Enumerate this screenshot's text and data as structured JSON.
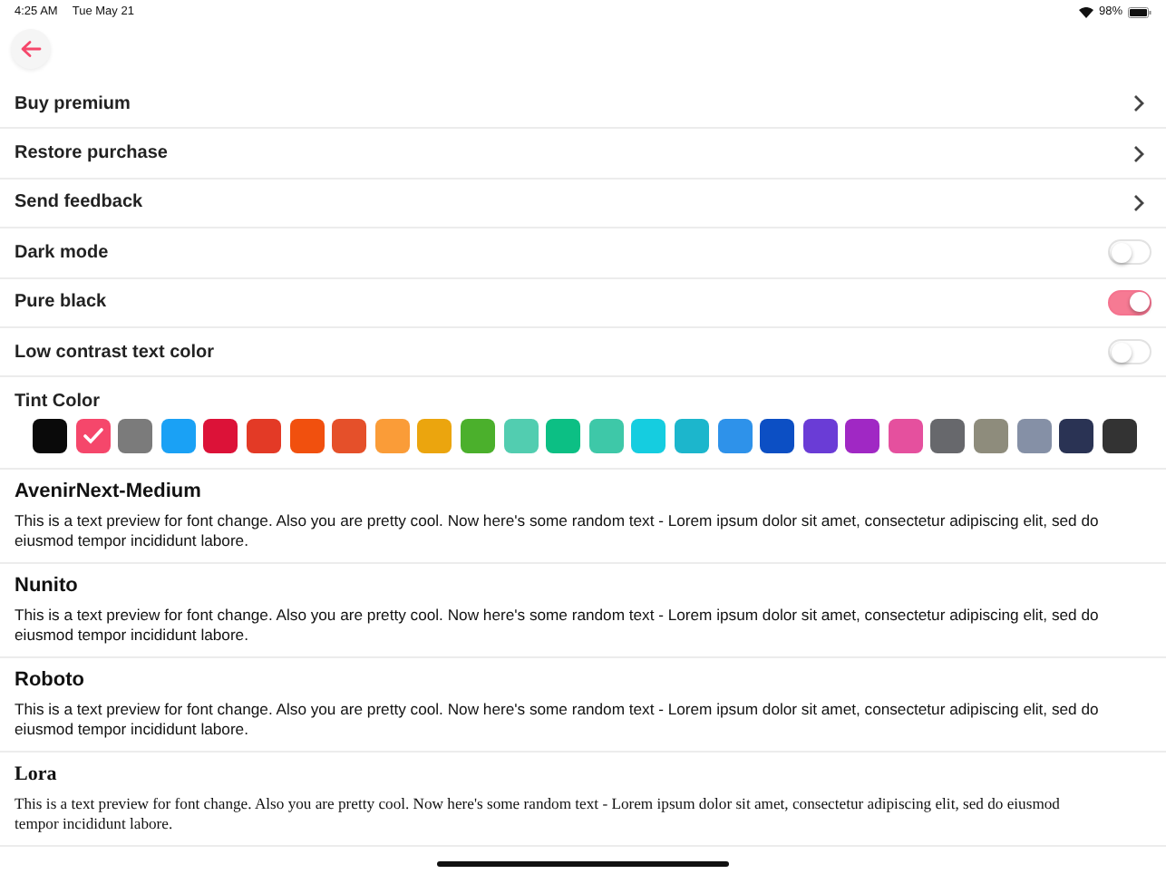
{
  "status_bar": {
    "time": "4:25 AM",
    "date": "Tue May 21",
    "battery": "98%"
  },
  "settings": [
    {
      "kind": "link",
      "label": "Buy premium"
    },
    {
      "kind": "link",
      "label": "Restore purchase"
    },
    {
      "kind": "link",
      "label": "Send feedback"
    },
    {
      "kind": "toggle",
      "label": "Dark mode",
      "on": false
    },
    {
      "kind": "toggle",
      "label": "Pure black",
      "on": true
    },
    {
      "kind": "toggle",
      "label": "Low contrast text color",
      "on": false
    }
  ],
  "tint": {
    "label": "Tint Color",
    "swatches": [
      {
        "color": "#0a0a0a",
        "selected": false
      },
      {
        "color": "#f5476b",
        "selected": true
      },
      {
        "color": "#7b7b7b",
        "selected": false
      },
      {
        "color": "#1aa1f5",
        "selected": false
      },
      {
        "color": "#dc1238",
        "selected": false
      },
      {
        "color": "#e33a26",
        "selected": false
      },
      {
        "color": "#f1500e",
        "selected": false
      },
      {
        "color": "#e5502a",
        "selected": false
      },
      {
        "color": "#fa9c38",
        "selected": false
      },
      {
        "color": "#eba50e",
        "selected": false
      },
      {
        "color": "#4bb02c",
        "selected": false
      },
      {
        "color": "#52cdb0",
        "selected": false
      },
      {
        "color": "#0cbf84",
        "selected": false
      },
      {
        "color": "#3ec8a8",
        "selected": false
      },
      {
        "color": "#15cde0",
        "selected": false
      },
      {
        "color": "#1cb6cc",
        "selected": false
      },
      {
        "color": "#2e92ea",
        "selected": false
      },
      {
        "color": "#0c4fc4",
        "selected": false
      },
      {
        "color": "#6a3cd6",
        "selected": false
      },
      {
        "color": "#a028c4",
        "selected": false
      },
      {
        "color": "#e5509e",
        "selected": false
      },
      {
        "color": "#67686c",
        "selected": false
      },
      {
        "color": "#8e8c7c",
        "selected": false
      },
      {
        "color": "#8590a6",
        "selected": false
      },
      {
        "color": "#2a3354",
        "selected": false
      },
      {
        "color": "#333333",
        "selected": false
      }
    ]
  },
  "fonts": [
    {
      "kind": "sans",
      "name": "AvenirNext-Medium",
      "preview": "This is a text preview for font change. Also you are pretty cool. Now here's some random text - Lorem ipsum dolor sit amet, consectetur adipiscing elit, sed do eiusmod tempor incididunt labore."
    },
    {
      "kind": "sans",
      "name": "Nunito",
      "preview": "This is a text preview for font change. Also you are pretty cool. Now here's some random text - Lorem ipsum dolor sit amet, consectetur adipiscing elit, sed do eiusmod tempor incididunt labore."
    },
    {
      "kind": "sans",
      "name": "Roboto",
      "preview": "This is a text preview for font change. Also you are pretty cool. Now here's some random text - Lorem ipsum dolor sit amet, consectetur adipiscing elit, sed do eiusmod tempor incididunt labore."
    },
    {
      "kind": "serif",
      "name": "Lora",
      "preview": "This is a text preview for font change. Also you are pretty cool. Now here's some random text - Lorem ipsum dolor sit amet, consectetur adipiscing elit, sed do eiusmod tempor incididunt labore."
    }
  ]
}
